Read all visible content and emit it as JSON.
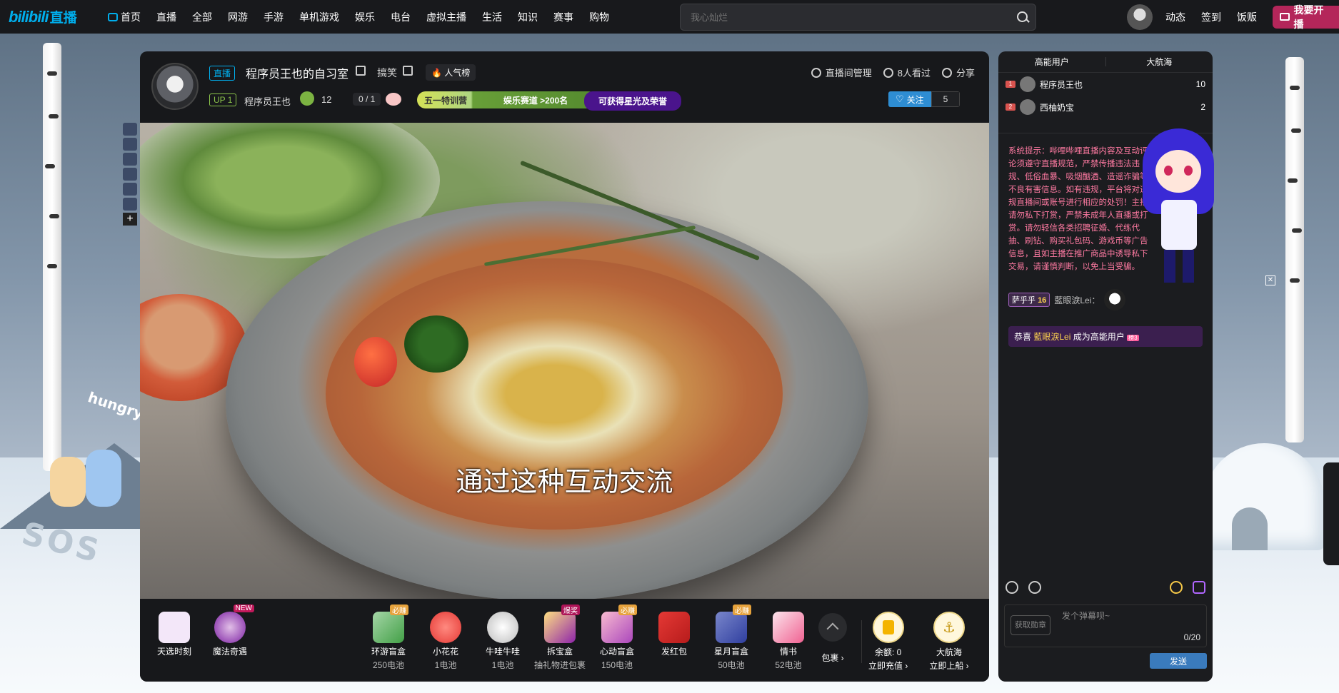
{
  "nav": {
    "logo": "bilibili",
    "logo_sub": "直播",
    "items": [
      "首页",
      "直播",
      "全部",
      "网游",
      "手游",
      "单机游戏",
      "娱乐",
      "电台",
      "虚拟主播",
      "生活",
      "知识",
      "赛事",
      "购物"
    ]
  },
  "search": {
    "placeholder": "我心灿烂"
  },
  "top_right": {
    "links": [
      "动态",
      "签到",
      "饭贩"
    ],
    "live_button": "我要开播"
  },
  "room": {
    "live_tag": "直播",
    "title": "程序员王也的自习室",
    "area": "搞笑",
    "hot_rank": "人气榜",
    "manage": "直播间管理",
    "viewers": "8人看过",
    "share": "分享",
    "up_badge": "UP 1",
    "host_name": "程序员王也",
    "fan_count": "12",
    "task_progress": "0 / 1",
    "rank_left": "五一特训营",
    "rank_right": "娱乐赛道 >200名",
    "star_button": "可获得星光及荣誉",
    "follow_label": "关注",
    "follow_count": "5"
  },
  "video": {
    "subtitle": "通过这种互动交流"
  },
  "gifts": {
    "left": [
      {
        "name": "天选时刻"
      },
      {
        "name": "魔法奇遇",
        "corner": "NEW"
      }
    ],
    "main": [
      {
        "name": "环游盲盒",
        "price": "250电池",
        "corner": "必赚"
      },
      {
        "name": "小花花",
        "price": "1电池"
      },
      {
        "name": "牛哇牛哇",
        "price": "1电池"
      },
      {
        "name": "拆宝盒",
        "price": "抽礼物进包裹",
        "corner": "爆奖"
      },
      {
        "name": "心动盲盒",
        "price": "150电池",
        "corner": "必赚"
      },
      {
        "name": "发红包",
        "price": ""
      },
      {
        "name": "星月盲盒",
        "price": "50电池",
        "corner": "必赚"
      },
      {
        "name": "情书",
        "price": "52电池"
      }
    ],
    "pack": "包裹 ›",
    "balance": "余额: 0",
    "recharge": "立即充值 ›",
    "fleet": "大航海",
    "board": "立即上船 ›"
  },
  "chat": {
    "tabs": [
      "高能用户",
      "大航海"
    ],
    "ranks": [
      {
        "rank": "1",
        "name": "程序员王也",
        "score": "10"
      },
      {
        "rank": "2",
        "name": "西柚奶宝",
        "score": "2"
      }
    ],
    "system_message": "系统提示：哔哩哔哩直播内容及互动评论须遵守直播规范，严禁传播违法违规、低俗血暴、吸烟酗酒、造谣诈骗等不良有害信息。如有违规，平台将对违规直播间或账号进行相应的处罚！主播请勿私下打赏，严禁未成年人直播或打赏。请勿轻信各类招聘征婚、代练代抽、刷钻、购买礼包码、游戏币等广告信息，且如主播在推广商品中诱导私下交易，请谨慎判断，以免上当受骗。",
    "danmu_medal": "萨乎乎",
    "danmu_level": "16",
    "danmu_user": "藍眼淚Lei：",
    "welcome_prefix": "恭喜",
    "welcome_user": "藍眼淚Lei",
    "welcome_suffix": "成为高能用户",
    "welcome_level": "榜3",
    "medal_get": "获取勋章",
    "input_placeholder": "发个弹幕呗~",
    "counter": "0/20",
    "send": "发送"
  },
  "deco": {
    "hungry": "hungry",
    "sos": "SOS"
  }
}
